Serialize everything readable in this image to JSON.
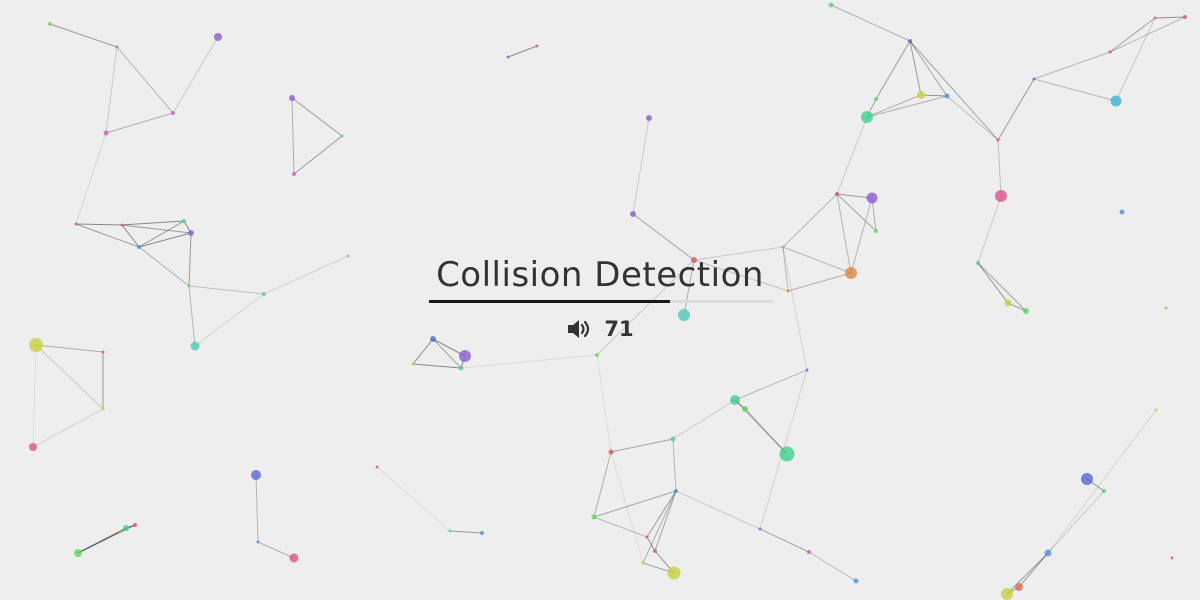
{
  "title": "Collision Detection",
  "progress": 0.7,
  "volume": {
    "icon": "speaker-volume-icon",
    "value": "71"
  },
  "colors": {
    "background": "#eeeeee",
    "text": "#333333",
    "progress_fill": "#1a1a1a",
    "progress_track": "#dcdcdc"
  }
}
